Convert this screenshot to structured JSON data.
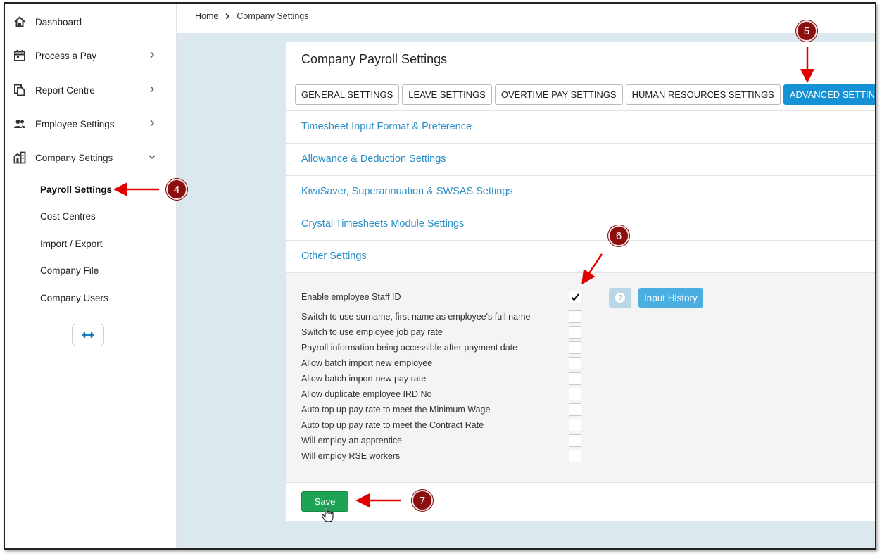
{
  "sidebar": {
    "items": [
      {
        "label": "Dashboard",
        "icon": "home-icon"
      },
      {
        "label": "Process a Pay",
        "icon": "calendar-icon"
      },
      {
        "label": "Report Centre",
        "icon": "document-icon"
      },
      {
        "label": "Employee Settings",
        "icon": "people-icon"
      },
      {
        "label": "Company Settings",
        "icon": "building-icon"
      }
    ],
    "sub_items": [
      "Payroll Settings",
      "Cost Centres",
      "Import / Export",
      "Company File",
      "Company Users"
    ],
    "collapse_icon": "double-arrow-icon"
  },
  "breadcrumb": {
    "home": "Home",
    "current": "Company Settings"
  },
  "panel": {
    "title": "Company Payroll Settings",
    "tabs": [
      "GENERAL SETTINGS",
      "LEAVE SETTINGS",
      "OVERTIME PAY SETTINGS",
      "HUMAN RESOURCES SETTINGS",
      "ADVANCED SETTINGS"
    ],
    "sections": [
      "Timesheet Input Format & Preference",
      "Allowance & Deduction Settings",
      "KiwiSaver, Superannuation & SWSAS Settings",
      "Crystal Timesheets Module Settings",
      "Other Settings"
    ],
    "settings": [
      {
        "label": "Enable employee Staff ID",
        "checked": true
      },
      {
        "label": "Switch to use surname, first name as employee's full name",
        "checked": false
      },
      {
        "label": "Switch to use employee job pay rate",
        "checked": false
      },
      {
        "label": "Payroll information being accessible after payment date",
        "checked": false
      },
      {
        "label": "Allow batch import new employee",
        "checked": false
      },
      {
        "label": "Allow batch import new pay rate",
        "checked": false
      },
      {
        "label": "Allow duplicate employee IRD No",
        "checked": false
      },
      {
        "label": "Auto top up pay rate to meet the Minimum Wage",
        "checked": false
      },
      {
        "label": "Auto top up pay rate to meet the Contract Rate",
        "checked": false
      },
      {
        "label": "Will employ an apprentice",
        "checked": false
      },
      {
        "label": "Will employ RSE workers",
        "checked": false
      }
    ],
    "help_icon": "question-circle-icon",
    "input_history_label": "Input History",
    "save_label": "Save"
  },
  "annotations": {
    "step4": "4",
    "step5": "5",
    "step6": "6",
    "step7": "7"
  },
  "colors": {
    "accent": "#1592d6",
    "link": "#2a8fc7",
    "save": "#1ea355",
    "badge": "#8b0f0f",
    "arrow": "#e00000"
  }
}
